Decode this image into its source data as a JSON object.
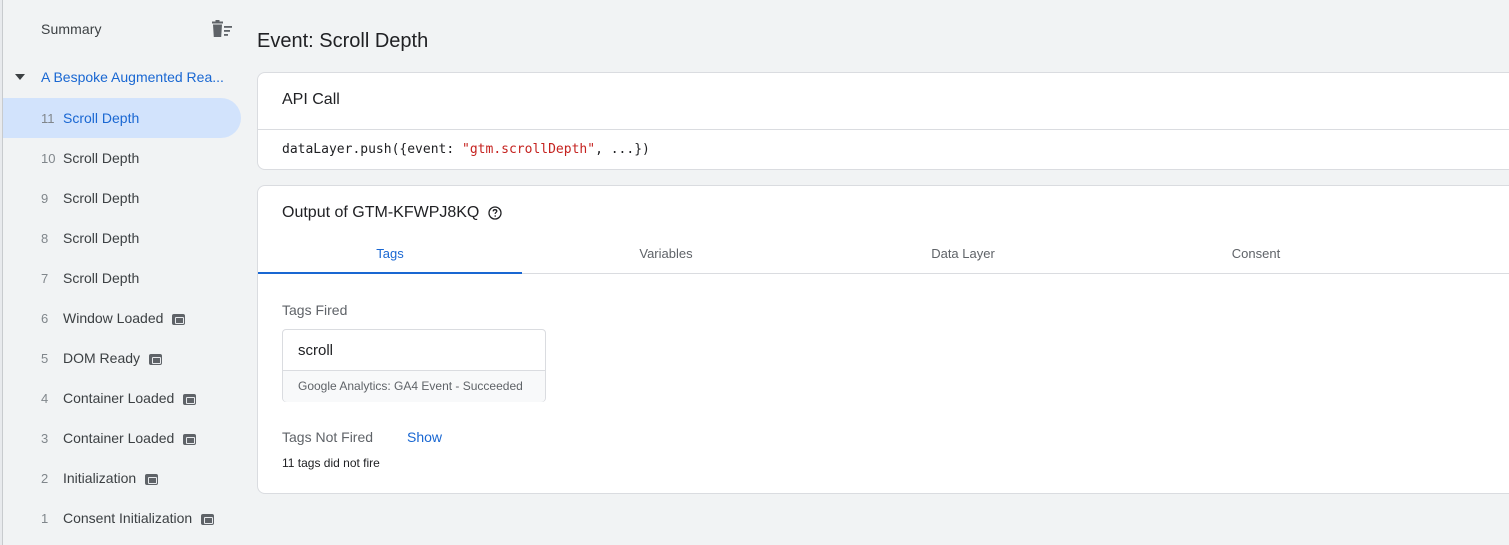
{
  "sidebar": {
    "summary_label": "Summary",
    "container_label": "A Bespoke Augmented Rea...",
    "events": [
      {
        "num": "11",
        "name": "Scroll Depth",
        "badge": false,
        "selected": true
      },
      {
        "num": "10",
        "name": "Scroll Depth",
        "badge": false
      },
      {
        "num": "9",
        "name": "Scroll Depth",
        "badge": false
      },
      {
        "num": "8",
        "name": "Scroll Depth",
        "badge": false
      },
      {
        "num": "7",
        "name": "Scroll Depth",
        "badge": false
      },
      {
        "num": "6",
        "name": "Window Loaded",
        "badge": true
      },
      {
        "num": "5",
        "name": "DOM Ready",
        "badge": true
      },
      {
        "num": "4",
        "name": "Container Loaded",
        "badge": true
      },
      {
        "num": "3",
        "name": "Container Loaded",
        "badge": true
      },
      {
        "num": "2",
        "name": "Initialization",
        "badge": true
      },
      {
        "num": "1",
        "name": "Consent Initialization",
        "badge": true
      }
    ]
  },
  "main": {
    "page_title": "Event: Scroll Depth",
    "api_call": {
      "title": "API Call",
      "code_prefix": "dataLayer.push({event: ",
      "code_string": "\"gtm.scrollDepth\"",
      "code_suffix": ", ...})"
    },
    "output": {
      "title": "Output of GTM-KFWPJ8KQ",
      "tabs": [
        {
          "label": "Tags",
          "active": true
        },
        {
          "label": "Variables"
        },
        {
          "label": "Data Layer"
        },
        {
          "label": "Consent"
        }
      ],
      "tags_fired_label": "Tags Fired",
      "fired_tag": {
        "name": "scroll",
        "subtitle": "Google Analytics: GA4 Event - Succeeded"
      },
      "tags_not_fired_label": "Tags Not Fired",
      "show_label": "Show",
      "not_fired_count": "11 tags did not fire"
    }
  },
  "colors": {
    "accent": "#1967d2",
    "selected_bg": "#d2e3fc",
    "page_bg": "#f1f3f4",
    "code_string": "#c5221f"
  }
}
